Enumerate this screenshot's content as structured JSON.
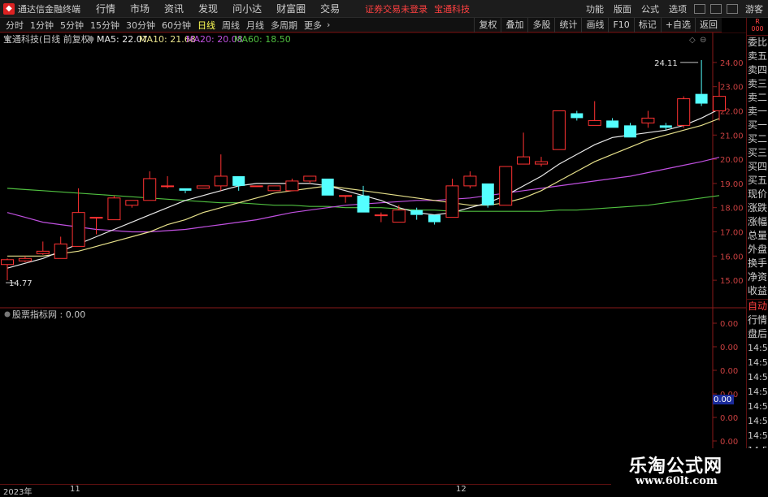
{
  "titlebar": {
    "app_name": "通达信金融终端",
    "menu": [
      "行情",
      "市场",
      "资讯",
      "发现",
      "问小达",
      "财富圈",
      "交易"
    ],
    "notice": "证券交易未登录",
    "stock_name": "宝通科技",
    "right_menu": [
      "功能",
      "版面",
      "公式",
      "选项"
    ],
    "guest": "游客"
  },
  "periods": [
    "分时",
    "1分钟",
    "5分钟",
    "15分钟",
    "30分钟",
    "60分钟",
    "日线",
    "周线",
    "月线",
    "多周期",
    "更多"
  ],
  "active_period": "日线",
  "toolbar": [
    "复权",
    "叠加",
    "多股",
    "统计",
    "画线",
    "F10",
    "标记",
    "+自选",
    "返回"
  ],
  "chart_header": {
    "title": "宝通科技(日线 前复权)",
    "ma5": "MA5: 22.07",
    "ma10": "MA10: 21.68",
    "ma20": "MA20: 20.08",
    "ma60": "MA60: 18.50",
    "colors": {
      "ma5": "#e8e8e8",
      "ma10": "#e6e08a",
      "ma20": "#c050e0",
      "ma60": "#50c040"
    }
  },
  "price_axis": [
    "24.00",
    "23.00",
    "22.00",
    "21.00",
    "20.00",
    "19.00",
    "18.00",
    "17.00",
    "16.00",
    "15.00"
  ],
  "annotations": {
    "high": "24.11",
    "low": "14.77"
  },
  "indicator": {
    "title": "股票指标网 : 0.00",
    "axis": [
      "0.00",
      "0.00",
      "0.00",
      "0.00",
      "0.00",
      "0.00",
      "0.00"
    ],
    "current": "0.00"
  },
  "right_panel": {
    "head": [
      "R",
      "000"
    ],
    "items": [
      "委比",
      "卖五",
      "卖四",
      "卖三",
      "卖二",
      "卖一",
      "买一",
      "买二",
      "买三",
      "买四",
      "买五",
      "现价",
      "涨跌",
      "涨幅",
      "总量",
      "外盘",
      "换手",
      "净资",
      "收益"
    ],
    "lower": [
      "自动",
      "行情",
      "盘后"
    ],
    "times": [
      "14:5",
      "14:5",
      "14:5",
      "14:5",
      "14:5",
      "14:5",
      "14:5",
      "14:5"
    ]
  },
  "date_axis": {
    "year": "2023年",
    "m1": "11",
    "m2": "12"
  },
  "watermark": {
    "line1": "乐淘公式网",
    "line2": "www.60lt.com"
  },
  "chart_data": {
    "type": "candlestick",
    "candles": [
      [
        15.65,
        15.85,
        15.0,
        15.9
      ],
      [
        15.8,
        15.9,
        15.75,
        16.0
      ],
      [
        16.1,
        16.2,
        16.05,
        16.6
      ],
      [
        15.9,
        16.5,
        15.9,
        16.8
      ],
      [
        16.4,
        17.8,
        16.4,
        18.8
      ],
      [
        17.6,
        17.6,
        16.9,
        17.6
      ],
      [
        17.5,
        18.4,
        17.5,
        18.5
      ],
      [
        18.1,
        18.3,
        18.0,
        18.3
      ],
      [
        18.3,
        19.2,
        18.3,
        19.5
      ],
      [
        18.9,
        18.9,
        18.8,
        19.3
      ],
      [
        18.8,
        18.7,
        18.6,
        18.8
      ],
      [
        18.8,
        18.9,
        18.8,
        18.9
      ],
      [
        18.9,
        19.3,
        18.7,
        20.2
      ],
      [
        19.3,
        18.9,
        18.7,
        19.3
      ],
      [
        18.9,
        18.9,
        18.9,
        18.9
      ],
      [
        18.7,
        18.9,
        18.7,
        18.9
      ],
      [
        18.7,
        19.1,
        18.7,
        19.2
      ],
      [
        19.1,
        19.3,
        19.0,
        19.3
      ],
      [
        19.2,
        18.5,
        18.5,
        19.2
      ],
      [
        18.5,
        18.5,
        18.2,
        18.5
      ],
      [
        18.5,
        17.8,
        17.8,
        18.9
      ],
      [
        17.7,
        17.7,
        17.4,
        17.8
      ],
      [
        17.4,
        17.9,
        17.4,
        18.1
      ],
      [
        17.9,
        17.7,
        17.5,
        18.0
      ],
      [
        17.7,
        17.4,
        17.3,
        17.7
      ],
      [
        17.6,
        18.9,
        17.6,
        19.2
      ],
      [
        18.9,
        19.3,
        18.8,
        19.5
      ],
      [
        19.0,
        18.1,
        18.0,
        19.0
      ],
      [
        18.1,
        19.7,
        18.1,
        19.7
      ],
      [
        19.8,
        20.1,
        19.8,
        21.1
      ],
      [
        19.8,
        19.9,
        19.7,
        20.1
      ],
      [
        20.4,
        22.0,
        20.4,
        22.0
      ],
      [
        21.9,
        21.7,
        21.6,
        22.0
      ],
      [
        21.4,
        21.6,
        21.4,
        22.4
      ],
      [
        21.6,
        21.3,
        21.3,
        21.7
      ],
      [
        21.4,
        20.9,
        20.9,
        21.5
      ],
      [
        21.5,
        21.7,
        21.3,
        22.0
      ],
      [
        21.4,
        21.3,
        21.2,
        21.5
      ],
      [
        21.4,
        22.5,
        21.3,
        22.6
      ],
      [
        22.7,
        22.3,
        22.2,
        24.1
      ],
      [
        22.0,
        22.6,
        21.6,
        23.2
      ]
    ],
    "ma5": [
      15.5,
      15.7,
      15.9,
      16.2,
      16.5,
      16.8,
      17.1,
      17.4,
      17.7,
      18.0,
      18.3,
      18.5,
      18.7,
      18.9,
      19.0,
      19.0,
      19.0,
      19.0,
      18.9,
      18.7,
      18.5,
      18.3,
      18.0,
      17.8,
      17.7,
      17.8,
      18.0,
      18.2,
      18.5,
      18.9,
      19.3,
      19.8,
      20.2,
      20.6,
      20.9,
      21.0,
      21.1,
      21.2,
      21.4,
      21.7,
      22.07
    ],
    "ma10": [
      16.0,
      16.0,
      16.0,
      16.1,
      16.2,
      16.4,
      16.6,
      16.8,
      17.0,
      17.3,
      17.5,
      17.8,
      18.0,
      18.2,
      18.4,
      18.6,
      18.7,
      18.8,
      18.9,
      18.8,
      18.7,
      18.6,
      18.5,
      18.4,
      18.3,
      18.2,
      18.1,
      18.1,
      18.2,
      18.4,
      18.7,
      19.1,
      19.5,
      19.9,
      20.2,
      20.5,
      20.8,
      21.0,
      21.2,
      21.4,
      21.68
    ],
    "ma20": [
      17.8,
      17.6,
      17.4,
      17.3,
      17.2,
      17.1,
      17.05,
      17.0,
      17.0,
      17.05,
      17.1,
      17.2,
      17.3,
      17.4,
      17.5,
      17.65,
      17.8,
      17.9,
      18.0,
      18.1,
      18.15,
      18.2,
      18.25,
      18.3,
      18.3,
      18.35,
      18.4,
      18.5,
      18.6,
      18.7,
      18.8,
      18.9,
      19.0,
      19.1,
      19.2,
      19.3,
      19.45,
      19.6,
      19.75,
      19.9,
      20.08
    ],
    "ma60": [
      18.8,
      18.75,
      18.7,
      18.65,
      18.6,
      18.55,
      18.5,
      18.45,
      18.4,
      18.35,
      18.3,
      18.25,
      18.2,
      18.2,
      18.15,
      18.1,
      18.1,
      18.05,
      18.05,
      18.0,
      18.0,
      18.0,
      17.95,
      17.9,
      17.9,
      17.85,
      17.85,
      17.85,
      17.85,
      17.85,
      17.85,
      17.9,
      17.9,
      17.95,
      18.0,
      18.05,
      18.1,
      18.2,
      18.3,
      18.4,
      18.5
    ],
    "ylim": [
      14.5,
      24.5
    ]
  }
}
